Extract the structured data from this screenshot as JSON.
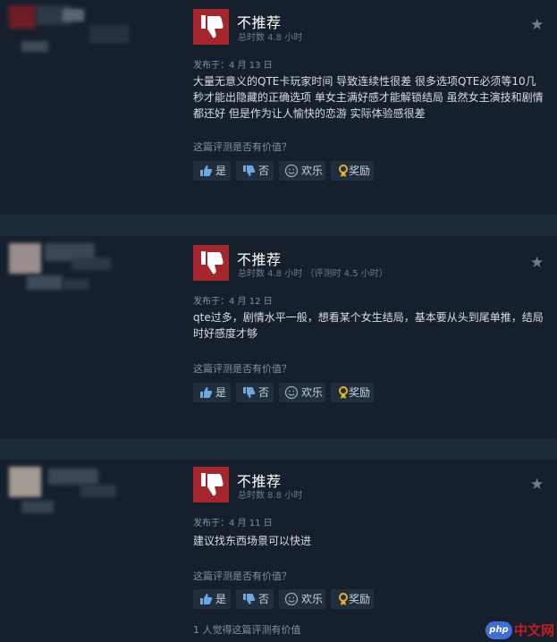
{
  "colors": {
    "background": "#1b2838",
    "card": "#16202d",
    "thumb_down": "#a4262c",
    "button_bg": "#212e3d",
    "button_text": "#c6d4df",
    "review_text": "#d7dde3",
    "muted_text": "#8191a1",
    "award_icon": "#e3b32d",
    "watermark_red": "#c21d23",
    "watermark_blue": "#3d6fd6"
  },
  "reviews": [
    {
      "verdict": "不推荐",
      "hours": "总时数 4.8 小时",
      "posted": "发布于：4 月 13 日",
      "text": "大量无意义的QTE卡玩家时间 导致连续性很差 很多选项QTE必须等10几秒才能出隐藏的正确选项 单女主满好感才能解锁结局 虽然女主演技和剧情都还好 但是作为让人愉快的恋游 实际体验感很差",
      "helpful_question": "这篇评测是否有价值？",
      "buttons": {
        "yes": "是",
        "no": "否",
        "funny": "欢乐",
        "award": "奖励"
      },
      "footnote": ""
    },
    {
      "verdict": "不推荐",
      "hours": "总时数 4.8 小时 （评测时 4.5 小时）",
      "posted": "发布于：4 月 12 日",
      "text": "qte过多，剧情水平一般，想看某个女生结局，基本要从头到尾单推，结局时好感度才够",
      "helpful_question": "这篇评测是否有价值？",
      "buttons": {
        "yes": "是",
        "no": "否",
        "funny": "欢乐",
        "award": "奖励"
      },
      "footnote": ""
    },
    {
      "verdict": "不推荐",
      "hours": "总时数 8.8 小时",
      "posted": "发布于：4 月 11 日",
      "text": "建议找东西场景可以快进",
      "helpful_question": "这篇评测是否有价值？",
      "buttons": {
        "yes": "是",
        "no": "否",
        "funny": "欢乐",
        "award": "奖励"
      },
      "footnote": "1 人觉得这篇评测有价值"
    }
  ],
  "watermark": {
    "logo": "php",
    "text": "中文网"
  }
}
